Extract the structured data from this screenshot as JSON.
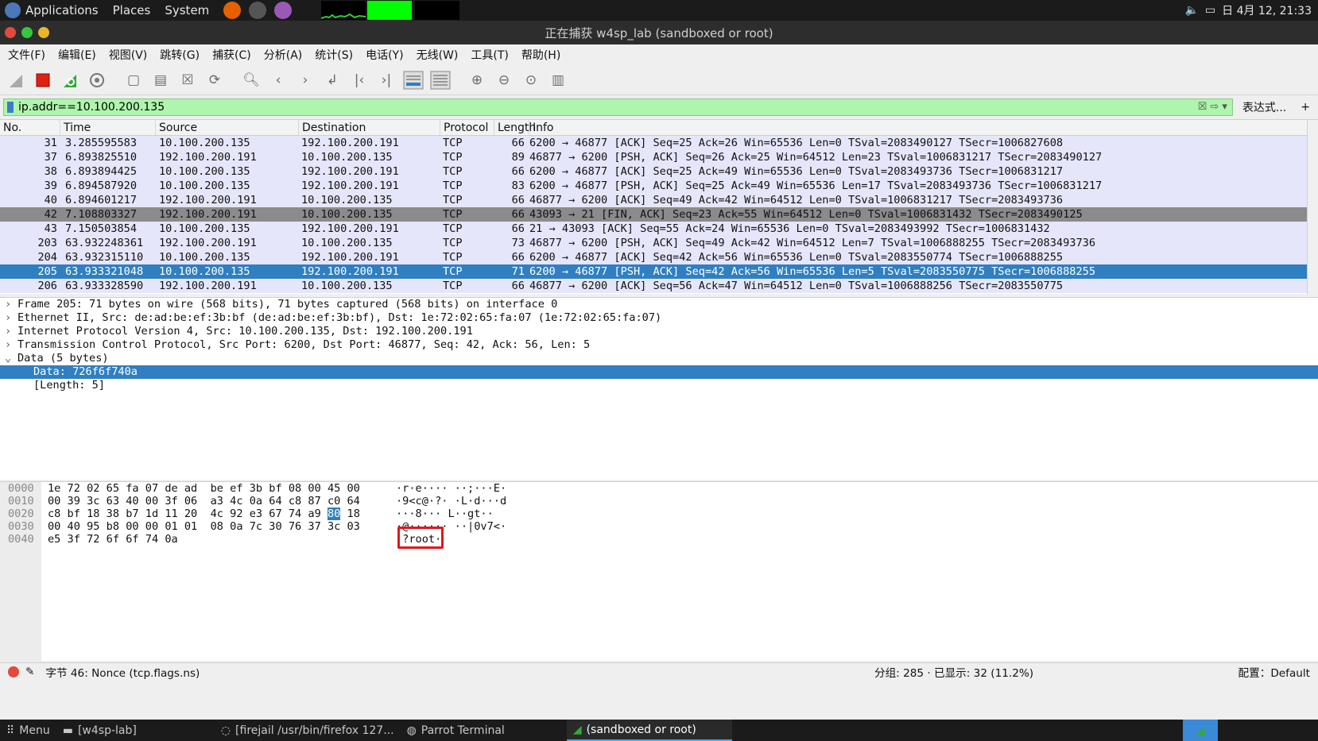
{
  "topbar": {
    "applications": "Applications",
    "places": "Places",
    "system": "System",
    "clock": "日 4月 12, 21:33"
  },
  "window": {
    "title": "正在捕获 w4sp_lab (sandboxed or root)"
  },
  "menubar": [
    "文件(F)",
    "编辑(E)",
    "视图(V)",
    "跳转(G)",
    "捕获(C)",
    "分析(A)",
    "统计(S)",
    "电话(Y)",
    "无线(W)",
    "工具(T)",
    "帮助(H)"
  ],
  "filter": {
    "value": "ip.addr==10.100.200.135",
    "expression_button": "表达式...",
    "add_button": "+"
  },
  "packet_list": {
    "columns": [
      "No.",
      "Time",
      "Source",
      "Destination",
      "Protocol",
      "Length",
      "Info"
    ],
    "rows": [
      {
        "no": "31",
        "time": "3.285595583",
        "src": "10.100.200.135",
        "dst": "192.100.200.191",
        "proto": "TCP",
        "len": "66",
        "info": "6200 → 46877 [ACK] Seq=25 Ack=26 Win=65536 Len=0 TSval=2083490127 TSecr=1006827608",
        "style": "normal"
      },
      {
        "no": "37",
        "time": "6.893825510",
        "src": "192.100.200.191",
        "dst": "10.100.200.135",
        "proto": "TCP",
        "len": "89",
        "info": "46877 → 6200 [PSH, ACK] Seq=26 Ack=25 Win=64512 Len=23 TSval=1006831217 TSecr=2083490127",
        "style": "normal"
      },
      {
        "no": "38",
        "time": "6.893894425",
        "src": "10.100.200.135",
        "dst": "192.100.200.191",
        "proto": "TCP",
        "len": "66",
        "info": "6200 → 46877 [ACK] Seq=25 Ack=49 Win=65536 Len=0 TSval=2083493736 TSecr=1006831217",
        "style": "normal"
      },
      {
        "no": "39",
        "time": "6.894587920",
        "src": "10.100.200.135",
        "dst": "192.100.200.191",
        "proto": "TCP",
        "len": "83",
        "info": "6200 → 46877 [PSH, ACK] Seq=25 Ack=49 Win=65536 Len=17 TSval=2083493736 TSecr=1006831217",
        "style": "normal"
      },
      {
        "no": "40",
        "time": "6.894601217",
        "src": "192.100.200.191",
        "dst": "10.100.200.135",
        "proto": "TCP",
        "len": "66",
        "info": "46877 → 6200 [ACK] Seq=49 Ack=42 Win=64512 Len=0 TSval=1006831217 TSecr=2083493736",
        "style": "normal"
      },
      {
        "no": "42",
        "time": "7.108803327",
        "src": "192.100.200.191",
        "dst": "10.100.200.135",
        "proto": "TCP",
        "len": "66",
        "info": "43093 → 21 [FIN, ACK] Seq=23 Ack=55 Win=64512 Len=0 TSval=1006831432 TSecr=2083490125",
        "style": "dark"
      },
      {
        "no": "43",
        "time": "7.150503854",
        "src": "10.100.200.135",
        "dst": "192.100.200.191",
        "proto": "TCP",
        "len": "66",
        "info": "21 → 43093 [ACK] Seq=55 Ack=24 Win=65536 Len=0 TSval=2083493992 TSecr=1006831432",
        "style": "normal"
      },
      {
        "no": "203",
        "time": "63.932248361",
        "src": "192.100.200.191",
        "dst": "10.100.200.135",
        "proto": "TCP",
        "len": "73",
        "info": "46877 → 6200 [PSH, ACK] Seq=49 Ack=42 Win=64512 Len=7 TSval=1006888255 TSecr=2083493736",
        "style": "normal"
      },
      {
        "no": "204",
        "time": "63.932315110",
        "src": "10.100.200.135",
        "dst": "192.100.200.191",
        "proto": "TCP",
        "len": "66",
        "info": "6200 → 46877 [ACK] Seq=42 Ack=56 Win=65536 Len=0 TSval=2083550774 TSecr=1006888255",
        "style": "normal"
      },
      {
        "no": "205",
        "time": "63.933321048",
        "src": "10.100.200.135",
        "dst": "192.100.200.191",
        "proto": "TCP",
        "len": "71",
        "info": "6200 → 46877 [PSH, ACK] Seq=42 Ack=56 Win=65536 Len=5 TSval=2083550775 TSecr=1006888255",
        "style": "sel"
      },
      {
        "no": "206",
        "time": "63.933328590",
        "src": "192.100.200.191",
        "dst": "10.100.200.135",
        "proto": "TCP",
        "len": "66",
        "info": "46877 → 6200 [ACK] Seq=56 Ack=47 Win=64512 Len=0 TSval=1006888256 TSecr=2083550775",
        "style": "normal"
      }
    ]
  },
  "details": [
    {
      "text": "Frame 205: 71 bytes on wire (568 bits), 71 bytes captured (568 bits) on interface 0",
      "arrow": "›",
      "style": "normal"
    },
    {
      "text": "Ethernet II, Src: de:ad:be:ef:3b:bf (de:ad:be:ef:3b:bf), Dst: 1e:72:02:65:fa:07 (1e:72:02:65:fa:07)",
      "arrow": "›",
      "style": "normal"
    },
    {
      "text": "Internet Protocol Version 4, Src: 10.100.200.135, Dst: 192.100.200.191",
      "arrow": "›",
      "style": "normal"
    },
    {
      "text": "Transmission Control Protocol, Src Port: 6200, Dst Port: 46877, Seq: 42, Ack: 56, Len: 5",
      "arrow": "›",
      "style": "normal"
    },
    {
      "text": "Data (5 bytes)",
      "arrow": "⌄",
      "style": "normal"
    },
    {
      "text": "Data: 726f6f740a",
      "arrow": "",
      "style": "sub-sel"
    },
    {
      "text": "[Length: 5]",
      "arrow": "",
      "style": "sub"
    }
  ],
  "hex": {
    "offsets": [
      "0000",
      "0010",
      "0020",
      "0030",
      "0040"
    ],
    "rows": [
      {
        "a": "1e 72 02 65 fa 07 de ad",
        "b": "be ef 3b bf 08 00 45 00",
        "ascii": "·r·e···· ··;···E·"
      },
      {
        "a": "00 39 3c 63 40 00 3f 06",
        "b": "a3 4c 0a 64 c8 87 c0 64",
        "ascii": "·9<c@·?· ·L·d···d"
      },
      {
        "a": "c8 bf 18 38 b7 1d 11 20",
        "b": "4c 92 e3 67 74 a9",
        "hl": "80",
        "tail": "18",
        "ascii": "···8···  L··gt··"
      },
      {
        "a": "00 40 95 b8 00 00 01 01",
        "b": "08 0a 7c 30 76 37 3c 03",
        "ascii": "·@······ ··|0v7<·"
      },
      {
        "a": "e5 3f 72 6f 6f 74 0a",
        "b": "",
        "ascii": "·?root·"
      }
    ]
  },
  "status": {
    "field": "字节 46: Nonce (tcp.flags.ns)",
    "packets": "分组: 285 · 已显示: 32 (11.2%)",
    "profile": "配置：Default"
  },
  "taskbar": {
    "menu": "Menu",
    "items": [
      "[w4sp-lab]",
      "[firejail /usr/bin/firefox 127...",
      "Parrot Terminal",
      "(sandboxed or root)"
    ]
  },
  "colors": {
    "selected": "#2f7fc1",
    "filter_ok": "#aff5ad",
    "row_tcp": "#e6e6fb",
    "highlight_box": "#e0161f"
  }
}
